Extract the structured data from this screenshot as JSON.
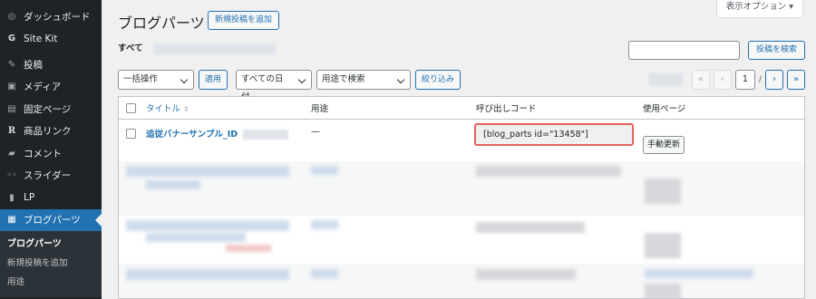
{
  "sidebar": {
    "items": [
      {
        "label": "ダッシュボード",
        "icon": "dashboard-icon",
        "glyph": "◎"
      },
      {
        "label": "Site Kit",
        "icon": "sitekit-icon",
        "glyph": "G"
      },
      {
        "label": "投稿",
        "icon": "pin-icon",
        "glyph": "✎"
      },
      {
        "label": "メディア",
        "icon": "media-icon",
        "glyph": "▣"
      },
      {
        "label": "固定ページ",
        "icon": "page-icon",
        "glyph": "▤"
      },
      {
        "label": "商品リンク",
        "icon": "rinker-icon",
        "glyph": "R"
      },
      {
        "label": "コメント",
        "icon": "comment-icon",
        "glyph": "▰"
      },
      {
        "label": "スライダー",
        "icon": "slider-icon",
        "glyph": "◦◦"
      },
      {
        "label": "LP",
        "icon": "lp-icon",
        "glyph": "▮"
      },
      {
        "label": "ブログパーツ",
        "icon": "blogparts-icon",
        "glyph": "▦"
      }
    ],
    "submenu": [
      "ブログパーツ",
      "新規投稿を追加",
      "用途"
    ]
  },
  "header": {
    "screen_options": "表示オプション ▾",
    "title": "ブログパーツ",
    "add_new": "新規投稿を追加",
    "filter_all": "すべて",
    "search_button": "投稿を検索",
    "search_value": ""
  },
  "tablenav": {
    "bulk_action": "一括操作",
    "apply": "適用",
    "date_filter": "すべての日付",
    "usage_filter": "用途で検索",
    "filter_button": "絞り込み",
    "pager": {
      "first": "«",
      "prev": "‹",
      "current_page": "1",
      "sep": "/",
      "next": "›",
      "last": "»"
    }
  },
  "table": {
    "columns": {
      "title": "タイトル",
      "usage": "用途",
      "shortcode": "呼び出しコード",
      "used_pages": "使用ページ"
    },
    "rows": [
      {
        "title": "追従バナーサンプル_ID",
        "usage": "—",
        "shortcode": "[blog_parts id=\"13458\"]",
        "action": "手動更新"
      }
    ]
  }
}
